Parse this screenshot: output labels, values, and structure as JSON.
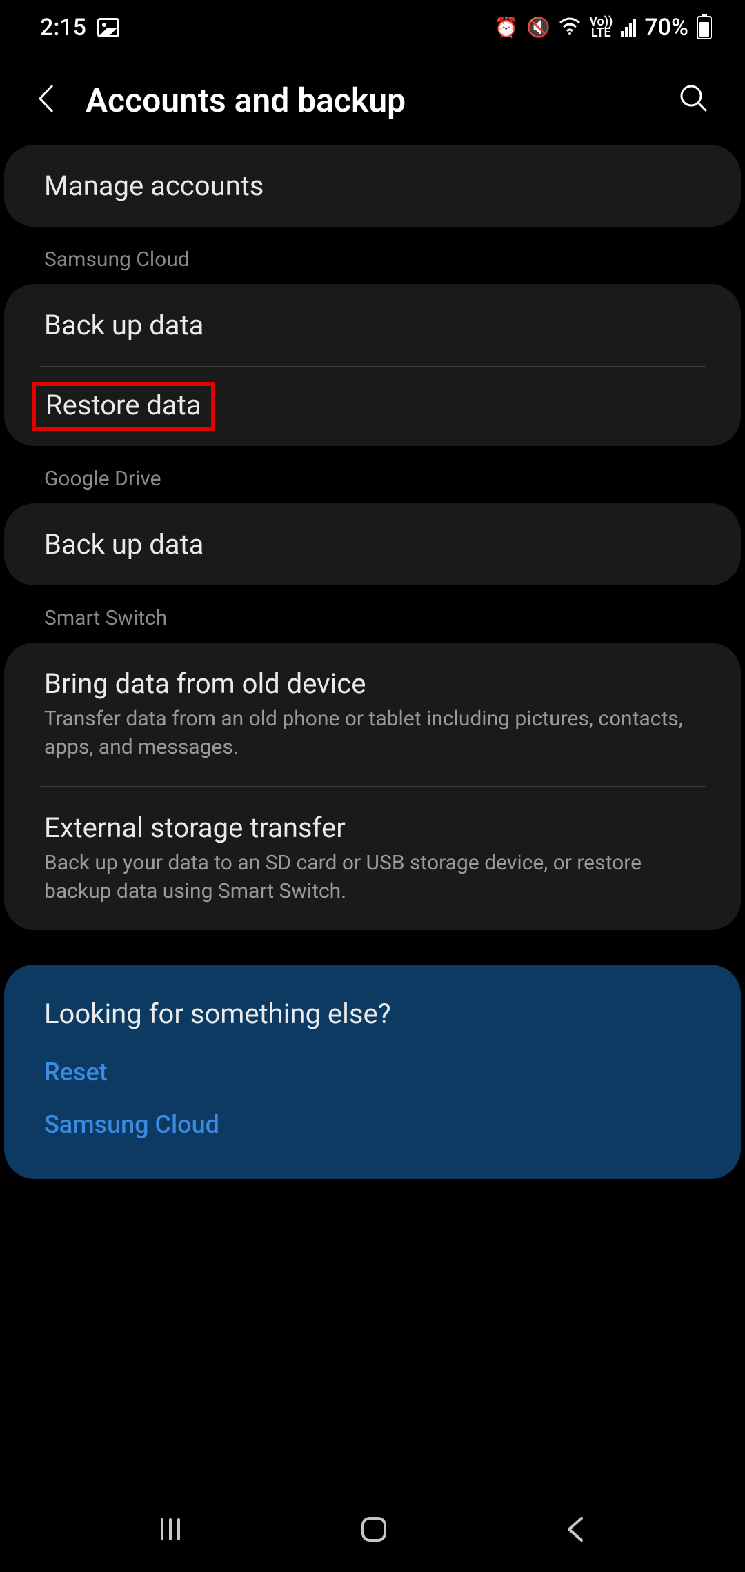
{
  "status": {
    "time": "2:15",
    "battery": "70%",
    "volte_top": "Vo))",
    "volte_bot": "LTE"
  },
  "header": {
    "title": "Accounts and backup"
  },
  "group_accounts": {
    "manage": "Manage accounts"
  },
  "samsung_cloud": {
    "label": "Samsung Cloud",
    "backup": "Back up data",
    "restore": "Restore data"
  },
  "google_drive": {
    "label": "Google Drive",
    "backup": "Back up data"
  },
  "smart_switch": {
    "label": "Smart Switch",
    "bring_title": "Bring data from old device",
    "bring_sub": "Transfer data from an old phone or tablet including pictures, contacts, apps, and messages.",
    "ext_title": "External storage transfer",
    "ext_sub": "Back up your data to an SD card or USB storage device, or restore backup data using Smart Switch."
  },
  "footer": {
    "title": "Looking for something else?",
    "reset": "Reset",
    "cloud": "Samsung Cloud"
  }
}
